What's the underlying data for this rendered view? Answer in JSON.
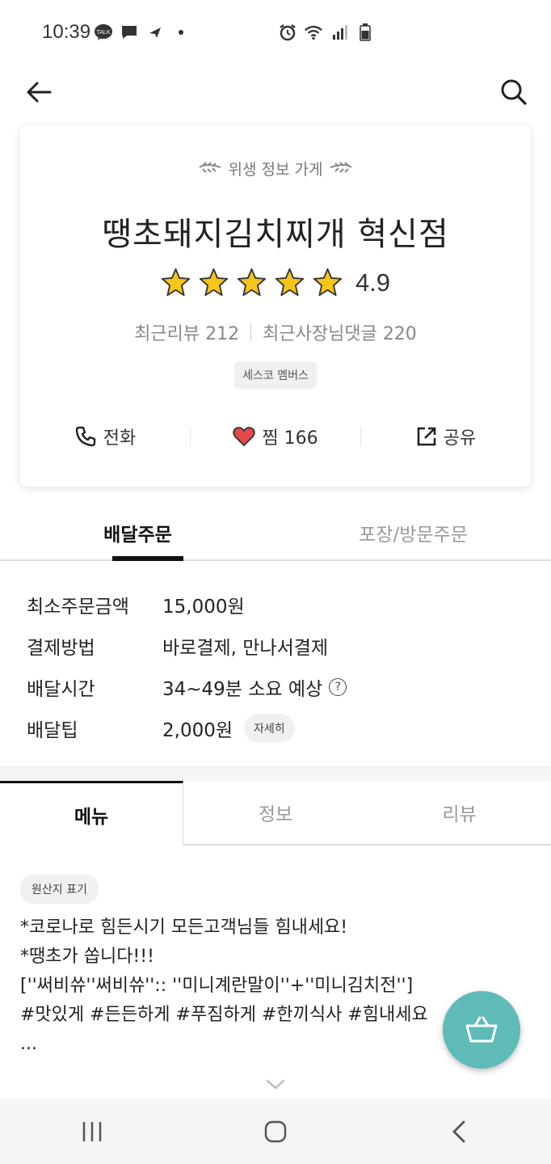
{
  "status_bar": {
    "time": "10:39",
    "icons": [
      "kakaotalk-icon",
      "message-icon",
      "navigation-icon",
      "dot-icon",
      "alarm-icon",
      "wifi-icon",
      "signal-icon",
      "battery-icon"
    ]
  },
  "app_bar": {
    "back_icon": "arrow-left-icon",
    "search_icon": "search-icon"
  },
  "store": {
    "hygiene_label": "위생 정보 가게",
    "name": "땡초돼지김치찌개 혁신점",
    "stars": 5,
    "rating": "4.9",
    "recent_reviews": "최근리뷰 212",
    "recent_owner_replies": "최근사장님댓글 220",
    "badge": "세스코 멤버스",
    "actions": {
      "call": "전화",
      "like": "찜 166",
      "share": "공유"
    }
  },
  "order_tabs": [
    {
      "label": "배달주문",
      "active": true
    },
    {
      "label": "포장/방문주문",
      "active": false
    }
  ],
  "info": {
    "min_order_label": "최소주문금액",
    "min_order_value": "15,000원",
    "payment_label": "결제방법",
    "payment_value": "바로결제, 만나서결제",
    "delivery_time_label": "배달시간",
    "delivery_time_value": "34~49분 소요 예상",
    "delivery_tip_label": "배달팁",
    "delivery_tip_value": "2,000원",
    "detail_button": "자세히"
  },
  "section_tabs": [
    {
      "label": "메뉴",
      "active": true
    },
    {
      "label": "정보",
      "active": false
    },
    {
      "label": "리뷰",
      "active": false
    }
  ],
  "menu": {
    "origin_chip": "원산지 표기",
    "notice_lines": [
      "*코로나로 힘든시기 모든고객님들 힘내세요!",
      "*땡초가 쏩니다!!!",
      "[''써비쓔''써비쓔'':: ''미니계란말이''+''미니김치전'']",
      "#맛있게 #든든하게 #푸짐하게 #한끼식사 #힘내세요",
      "..."
    ]
  },
  "colors": {
    "accent": "#5ebbb8",
    "heart": "#e34a4a",
    "star": "#f5c518"
  }
}
